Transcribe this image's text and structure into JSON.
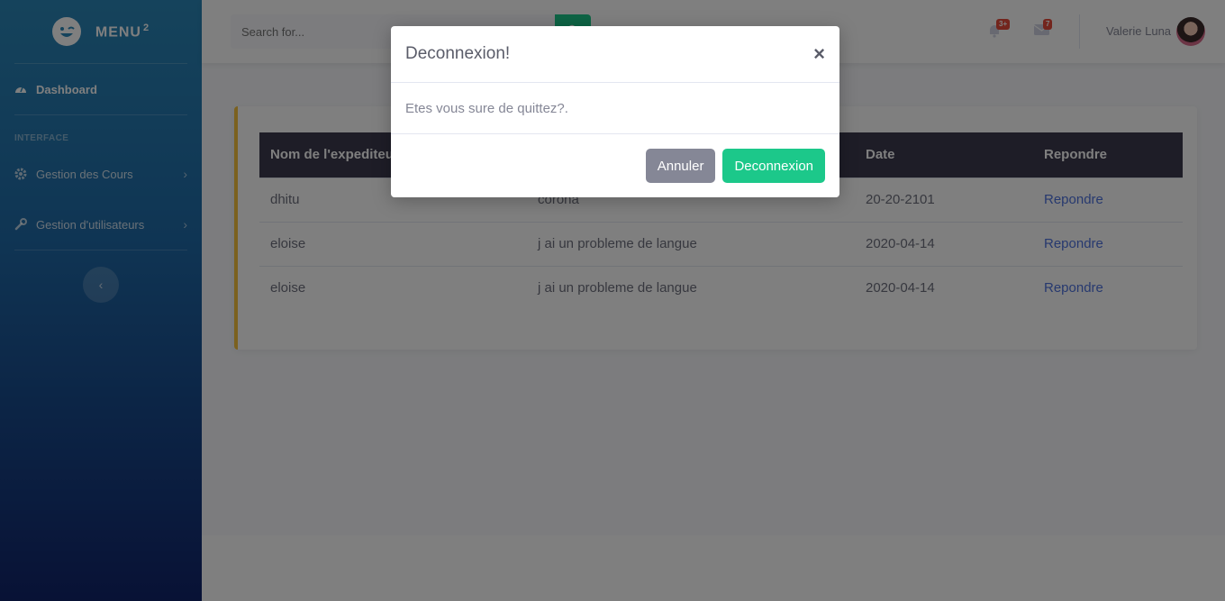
{
  "sidebar": {
    "brand": "MENU",
    "brand_sup": "2",
    "dashboard": "Dashboard",
    "heading": "INTERFACE",
    "items": [
      {
        "label": "Gestion des Cours"
      },
      {
        "label": "Gestion d'utilisateurs"
      }
    ]
  },
  "topbar": {
    "search_placeholder": "Search for...",
    "alerts_badge": "3+",
    "messages_badge": "7",
    "username": "Valerie Luna"
  },
  "table": {
    "headers": [
      "Nom de l'expediteur",
      "",
      "Date",
      "Repondre"
    ],
    "rows": [
      {
        "sender": "dhitu",
        "subject": "corona",
        "date": "20-20-2101",
        "action": "Repondre"
      },
      {
        "sender": "eloise",
        "subject": "j ai un probleme de langue",
        "date": "2020-04-14",
        "action": "Repondre"
      },
      {
        "sender": "eloise",
        "subject": "j ai un probleme de langue",
        "date": "2020-04-14",
        "action": "Repondre"
      }
    ]
  },
  "modal": {
    "title": "Deconnexion!",
    "close": "×",
    "body": "Etes vous sure de quittez?.",
    "cancel": "Annuler",
    "confirm": "Deconnexion"
  },
  "colors": {
    "success": "#1cc88a",
    "secondary": "#858796",
    "card_accent": "#f6c23e",
    "link": "#4e73df",
    "badge": "#e74a3b"
  }
}
